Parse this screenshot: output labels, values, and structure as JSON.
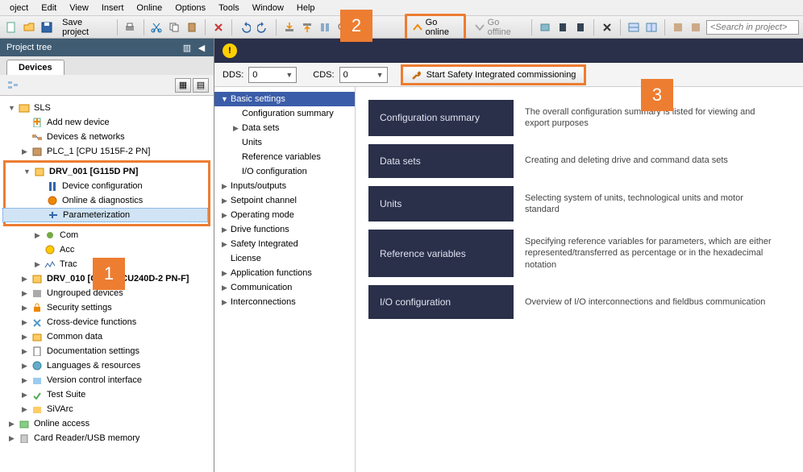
{
  "menubar": [
    "oject",
    "Edit",
    "View",
    "Insert",
    "Online",
    "Options",
    "Tools",
    "Window",
    "Help"
  ],
  "toolbar": {
    "save_label": "Save project",
    "go_online": "Go online",
    "go_offline": "Go offline",
    "search_placeholder": "<Search in project>"
  },
  "badges": {
    "b1": "1",
    "b2": "2",
    "b3": "3"
  },
  "project_tree": {
    "title": "Project tree",
    "tab": "Devices",
    "root": "SLS",
    "items": [
      "Add new device",
      "Devices & networks",
      "PLC_1 [CPU 1515F-2 PN]"
    ],
    "drv": {
      "name": "DRV_001 [G115D PN]",
      "children": [
        "Device configuration",
        "Online & diagnostics",
        "Parameterization"
      ]
    },
    "after_drv": [
      "Com",
      "Acc",
      "Trac"
    ],
    "drv2": "DRV_010 [G120D CU240D-2 PN-F]",
    "rest": [
      "Ungrouped devices",
      "Security settings",
      "Cross-device functions",
      "Common data",
      "Documentation settings",
      "Languages & resources",
      "Version control interface",
      "Test Suite",
      "SiVArc",
      "Online access",
      "Card Reader/USB memory"
    ]
  },
  "dds": {
    "dds_label": "DDS:",
    "dds_val": "0",
    "cds_label": "CDS:",
    "cds_val": "0"
  },
  "safety_btn": "Start Safety Integrated commissioning",
  "pnav": {
    "basic": "Basic settings",
    "basic_children": [
      "Configuration summary",
      "Data sets",
      "Units",
      "Reference variables",
      "I/O configuration"
    ],
    "rest": [
      "Inputs/outputs",
      "Setpoint channel",
      "Operating mode",
      "Drive functions",
      "Safety Integrated",
      "License",
      "Application functions",
      "Communication",
      "Interconnections"
    ]
  },
  "cards": [
    {
      "title": "Configuration summary",
      "desc": "The overall configuration summary is listed for viewing and export purposes"
    },
    {
      "title": "Data sets",
      "desc": "Creating and deleting drive and command data sets"
    },
    {
      "title": "Units",
      "desc": "Selecting system of units, technological units and motor standard"
    },
    {
      "title": "Reference variables",
      "desc": "Specifying reference variables for parameters, which are either represented/transferred as percentage or in the hexadecimal notation"
    },
    {
      "title": "I/O configuration",
      "desc": "Overview of I/O interconnections and fieldbus communication"
    }
  ]
}
